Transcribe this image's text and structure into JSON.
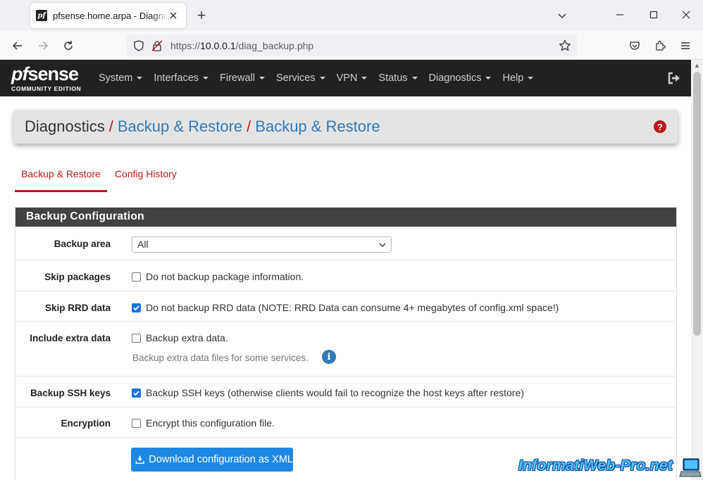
{
  "browser": {
    "tab_title": "pfsense.home.arpa - Diagnostics: Backup & Restore",
    "favicon_text": "pf",
    "url_prefix": "https://",
    "url_host": "10.0.0.1",
    "url_path": "/diag_backup.php"
  },
  "header": {
    "logo_pf": "pf",
    "logo_sense": "sense",
    "logo_edition": "COMMUNITY EDITION",
    "menu": [
      "System",
      "Interfaces",
      "Firewall",
      "Services",
      "VPN",
      "Status",
      "Diagnostics",
      "Help"
    ]
  },
  "breadcrumb": {
    "root": "Diagnostics",
    "sep": "/",
    "level1": "Backup & Restore",
    "level2": "Backup & Restore",
    "help": "?"
  },
  "tabs": [
    {
      "label": "Backup & Restore",
      "active": true
    },
    {
      "label": "Config History",
      "active": false
    }
  ],
  "panel": {
    "title": "Backup Configuration",
    "rows": {
      "backup_area": {
        "label": "Backup area",
        "value": "All"
      },
      "skip_packages": {
        "label": "Skip packages",
        "text": "Do not backup package information.",
        "checked": false
      },
      "skip_rrd": {
        "label": "Skip RRD data",
        "text": "Do not backup RRD data (NOTE: RRD Data can consume 4+ megabytes of config.xml space!)",
        "checked": true
      },
      "extra_data": {
        "label": "Include extra data",
        "text": "Backup extra data.",
        "hint": "Backup extra data files for some services.",
        "checked": false
      },
      "ssh_keys": {
        "label": "Backup SSH keys",
        "text": "Backup SSH keys (otherwise clients would fail to recognize the host keys after restore)",
        "checked": true
      },
      "encryption": {
        "label": "Encryption",
        "text": "Encrypt this configuration file.",
        "checked": false
      }
    },
    "download_button": "Download configuration as XML"
  },
  "watermark": "InformatiWeb-Pro.net",
  "colors": {
    "pf_dark": "#212121",
    "pf_red": "#b71c1c",
    "link_blue": "#337ab7",
    "button_blue": "#1e88e5",
    "panel_heading": "#424242"
  }
}
